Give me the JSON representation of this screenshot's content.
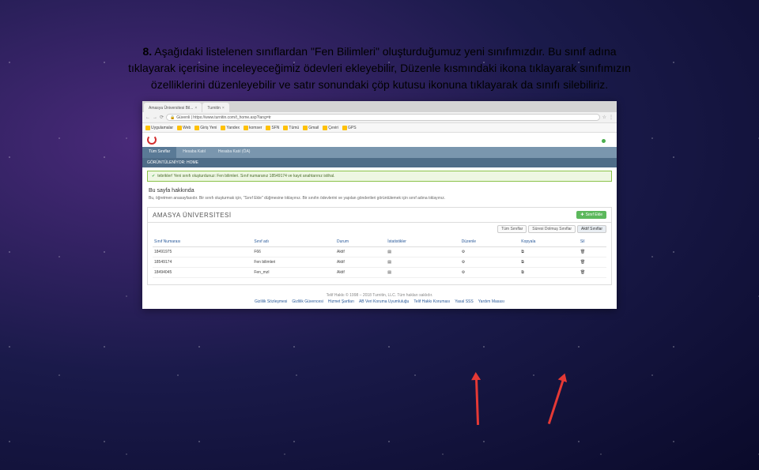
{
  "caption": {
    "prefix": "8.",
    "text_line1": " Aşağıdaki listelenen sınıflardan \"Fen Bilimleri\" oluşturduğumuz yeni sınıfımızdır. Bu sınıf adına",
    "text_line2": "tıklayarak içerisine inceleyeceğimiz ödevleri ekleyebilir, Düzenle kısmındaki ikona tıklayarak sınıfımızın",
    "text_line3": "özelliklerini düzenleyebilir ve satır sonundaki çöp kutusu ikonuna tıklayarak da sınıfı silebiliriz."
  },
  "browser": {
    "tabs": [
      {
        "title": "Amasya Üniversitesi Bil..."
      },
      {
        "title": "Turnitin"
      }
    ],
    "url": "https://www.turnitin.com/t_home.asp?lang=tr",
    "lock_label": "Güvenli",
    "bookmarks": [
      "Uygulamalar",
      "Web",
      "Giriş Yeni",
      "Yandex",
      "komser",
      "SFN",
      "Tümü",
      "Gmail",
      "Çeviri",
      "GPS"
    ]
  },
  "page": {
    "main_tabs": [
      "Tüm Sınıflar",
      "Hesaba Katıl",
      "Hesaba Katıl (ÖA)"
    ],
    "subhead": "GÖRÜNTÜLENİYOR: HOME",
    "alert": "tebrikler! Yeni sınıfı oluşturdunuz: Fen bilimleri. Sınıf numaranız 18549174 ve kayıt anahtarınız istihal.",
    "help_title": "Bu sayfa hakkında",
    "help_text": "Bu, öğretmen anasayfasıdır. Bir sınıfı oluşturmak için, \"Sınıf Ekle\" düğmesine tıklayınız. Bir sınıfın ödevlerini ve yapılan gönderileri görüntülemek için sınıf adına tıklayınız.",
    "university": "AMASYA ÜNİVERSİTESİ",
    "add_class": "Sınıf Ekle",
    "filters": [
      "Tüm Sınıflar",
      "Süresi Dolmuş Sınıflar",
      "Aktif Sınıflar"
    ],
    "table": {
      "headers": [
        "Sınıf Numarası",
        "Sınıf adı",
        "Durum",
        "İstatistikler",
        "Düzenle",
        "Kopyala",
        "Sil"
      ],
      "rows": [
        {
          "id": "18491975",
          "name": "F66",
          "status": "Aktif"
        },
        {
          "id": "18549174",
          "name": "Fen bilimleri",
          "status": "Aktif"
        },
        {
          "id": "18494045",
          "name": "Fen_mzl",
          "status": "Aktif"
        }
      ]
    },
    "footer_copy": "Telif Hakkı © 1998 – 2018 Turnitin, LLC. Tüm hakları saklıdır.",
    "footer_links": [
      "Gizlilik Sözleşmesi",
      "Gizlilik Güvencesi",
      "Hizmet Şartları",
      "AB Veri Koruma Uyumluluğu",
      "Telif Hakkı Koruması",
      "Yasal SSS",
      "Yardım Masası"
    ]
  },
  "icons": {
    "close": "×",
    "plus": "✚",
    "stats": "▤",
    "edit": "⚙",
    "copy": "⧉",
    "delete": "🗑",
    "check": "✔",
    "back": "←",
    "fwd": "→",
    "reload": "⟳",
    "star": "☆",
    "menu": "⋮"
  }
}
